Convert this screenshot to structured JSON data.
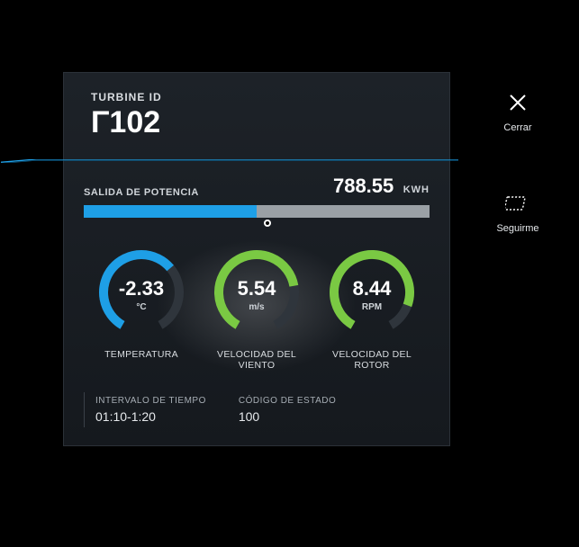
{
  "header": {
    "id_label": "TURBINE ID",
    "id_value": "Γ102"
  },
  "power": {
    "label": "SALIDA DE POTENCIA",
    "value": "788.55",
    "unit": "KWH",
    "fill_percent": 50
  },
  "gauges": [
    {
      "value": "-2.33",
      "unit": "°C",
      "caption": "TEMPERATURA",
      "arc_color": "#1e9fe6",
      "arc_degrees": 200
    },
    {
      "value": "5.54",
      "unit": "m/s",
      "caption": "VELOCIDAD DEL VIENTO",
      "arc_color": "#7ac943",
      "arc_degrees": 230
    },
    {
      "value": "8.44",
      "unit": "RPM",
      "caption": "VELOCIDAD DEL ROTOR",
      "arc_color": "#7ac943",
      "arc_degrees": 260
    }
  ],
  "footer": {
    "time_label": "INTERVALO DE TIEMPO",
    "time_value": "01:10-1:20",
    "status_label": "CÓDIGO DE ESTADO",
    "status_value": "100"
  },
  "actions": {
    "close": "Cerrar",
    "follow": "Seguirme"
  }
}
